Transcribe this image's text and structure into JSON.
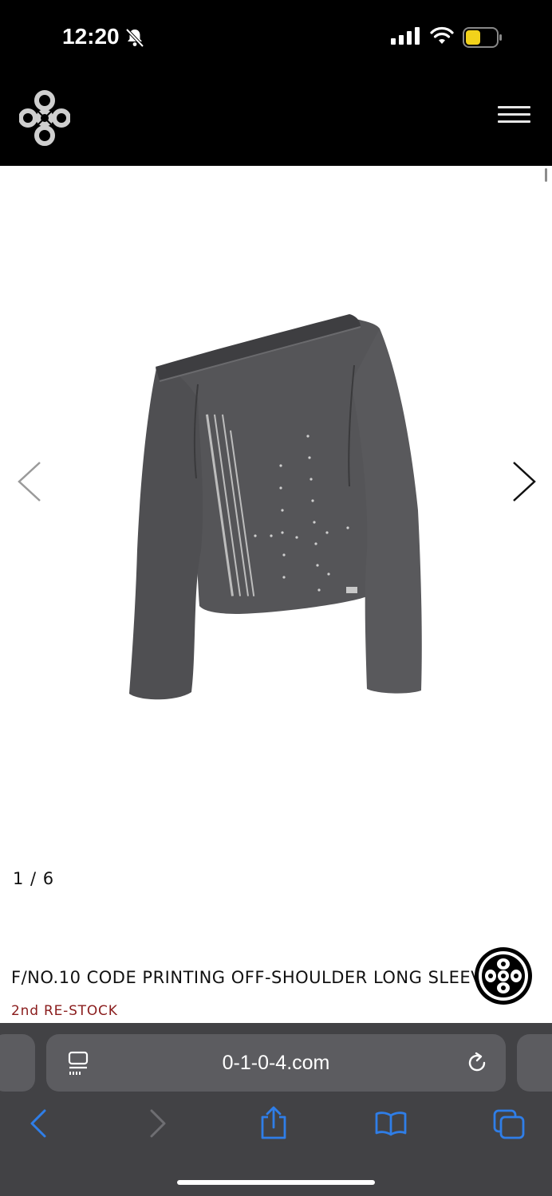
{
  "status_bar": {
    "time": "12:20"
  },
  "gallery": {
    "counter": "1 / 6"
  },
  "product": {
    "title": "F/NO.10 CODE PRINTING OFF-SHOULDER LONG SLEEVE",
    "badge": "2nd RE-STOCK"
  },
  "browser": {
    "url": "0-1-0-4.com"
  },
  "colors": {
    "header_bg": "#000000",
    "badge": "#8a1c1c",
    "toolbar_bg": "#424245",
    "toolbar_icon": "#2f7ee8"
  },
  "icons": [
    "brand-logo-icon",
    "menu-icon",
    "chevron-left-icon",
    "chevron-right-icon",
    "chat-icon",
    "reader-icon",
    "reload-icon",
    "back-icon",
    "forward-icon",
    "share-icon",
    "bookmarks-icon",
    "tabs-icon"
  ]
}
